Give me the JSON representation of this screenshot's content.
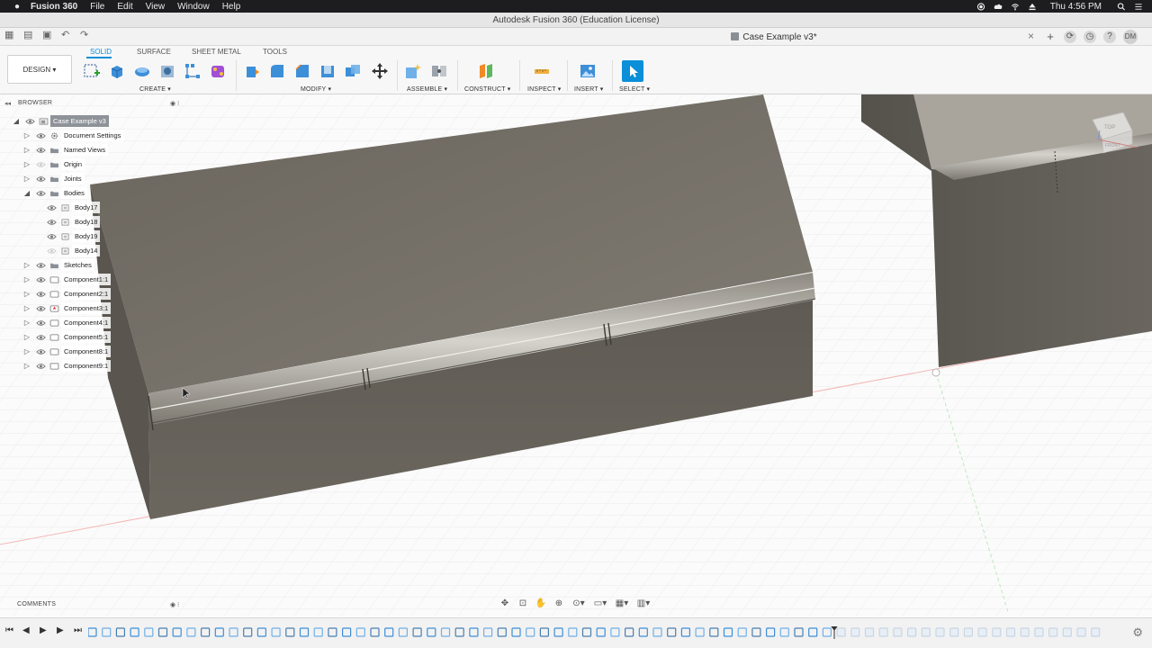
{
  "menubar": {
    "app": "Fusion 360",
    "items": [
      "File",
      "Edit",
      "View",
      "Window",
      "Help"
    ],
    "clock": "Thu 4:56 PM"
  },
  "window": {
    "title": "Autodesk Fusion 360 (Education License)"
  },
  "document_tab": {
    "title": "Case Example v3*",
    "user_initials": "DM"
  },
  "ribbon": {
    "workspace": "DESIGN",
    "tabs": [
      "SOLID",
      "SURFACE",
      "SHEET METAL",
      "TOOLS"
    ],
    "active_tab": "SOLID",
    "groups": [
      "CREATE",
      "MODIFY",
      "ASSEMBLE",
      "CONSTRUCT",
      "INSPECT",
      "INSERT",
      "SELECT"
    ]
  },
  "browser": {
    "header": "BROWSER",
    "items": [
      {
        "label": "Case Example v3",
        "level": 0
      },
      {
        "label": "Document Settings",
        "level": 1
      },
      {
        "label": "Named Views",
        "level": 1
      },
      {
        "label": "Origin",
        "level": 1
      },
      {
        "label": "Joints",
        "level": 1
      },
      {
        "label": "Bodies",
        "level": 1
      },
      {
        "label": "Body17",
        "level": 2
      },
      {
        "label": "Body18",
        "level": 2
      },
      {
        "label": "Body19",
        "level": 2
      },
      {
        "label": "Body14",
        "level": 2
      },
      {
        "label": "Sketches",
        "level": 1
      },
      {
        "label": "Component1:1",
        "level": 1
      },
      {
        "label": "Component2:1",
        "level": 1
      },
      {
        "label": "Component3:1",
        "level": 1
      },
      {
        "label": "Component4:1",
        "level": 1
      },
      {
        "label": "Component5:1",
        "level": 1
      },
      {
        "label": "Component8:1",
        "level": 1
      },
      {
        "label": "Component9:1",
        "level": 1
      }
    ]
  },
  "viewcube": {
    "top": "TOP",
    "front": "FRONT"
  },
  "comments": {
    "header": "COMMENTS"
  },
  "colors": {
    "accent": "#0a8fd8",
    "body": "#6f6a62",
    "hinge": "#b7b3ac",
    "menubar": "#1d1d1f"
  }
}
